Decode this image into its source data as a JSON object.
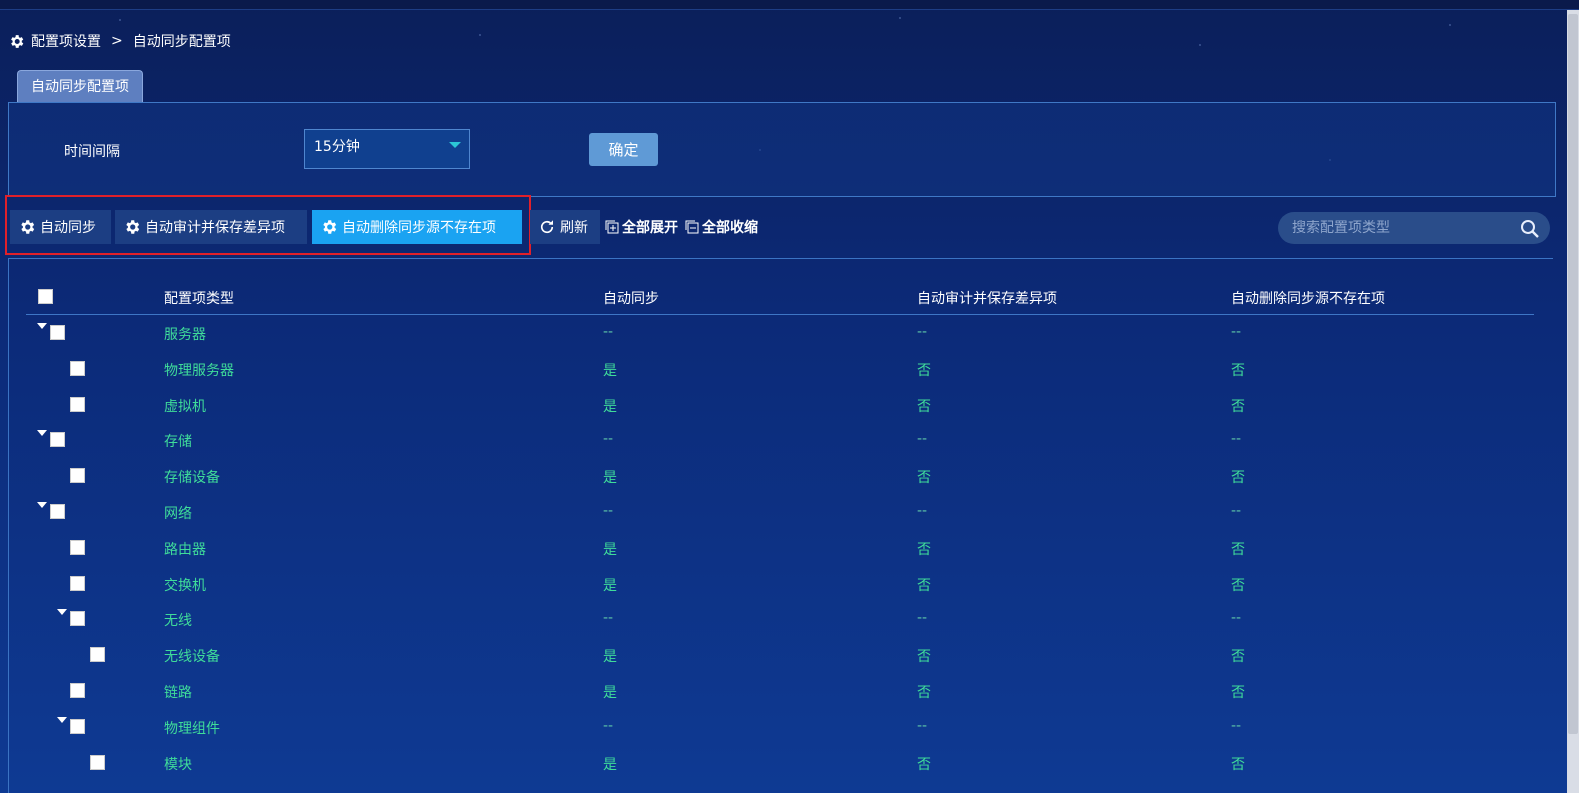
{
  "breadcrumb": {
    "parent": "配置项设置",
    "separator": ">",
    "current": "自动同步配置项"
  },
  "tab": {
    "label": "自动同步配置项"
  },
  "interval": {
    "label": "时间间隔",
    "value": "15分钟",
    "confirm": "确定"
  },
  "toolbar": {
    "auto_sync": "自动同步",
    "auto_audit": "自动审计并保存差异项",
    "auto_delete": "自动删除同步源不存在项",
    "refresh": "刷新",
    "expand_all": "全部展开",
    "collapse_all": "全部收缩"
  },
  "search": {
    "placeholder": "搜索配置项类型"
  },
  "columns": [
    "配置项类型",
    "自动同步",
    "自动审计并保存差异项",
    "自动删除同步源不存在项"
  ],
  "rows": [
    {
      "name": "服务器",
      "sync": "--",
      "audit": "--",
      "delete": "--",
      "level": 0,
      "group": true
    },
    {
      "name": "物理服务器",
      "sync": "是",
      "audit": "否",
      "delete": "否",
      "level": 1,
      "group": false
    },
    {
      "name": "虚拟机",
      "sync": "是",
      "audit": "否",
      "delete": "否",
      "level": 1,
      "group": false
    },
    {
      "name": "存储",
      "sync": "--",
      "audit": "--",
      "delete": "--",
      "level": 0,
      "group": true
    },
    {
      "name": "存储设备",
      "sync": "是",
      "audit": "否",
      "delete": "否",
      "level": 1,
      "group": false
    },
    {
      "name": "网络",
      "sync": "--",
      "audit": "--",
      "delete": "--",
      "level": 0,
      "group": true
    },
    {
      "name": "路由器",
      "sync": "是",
      "audit": "否",
      "delete": "否",
      "level": 1,
      "group": false
    },
    {
      "name": "交换机",
      "sync": "是",
      "audit": "否",
      "delete": "否",
      "level": 1,
      "group": false
    },
    {
      "name": "无线",
      "sync": "--",
      "audit": "--",
      "delete": "--",
      "level": 1,
      "group": true
    },
    {
      "name": "无线设备",
      "sync": "是",
      "audit": "否",
      "delete": "否",
      "level": 2,
      "group": false
    },
    {
      "name": "链路",
      "sync": "是",
      "audit": "否",
      "delete": "否",
      "level": 1,
      "group": false
    },
    {
      "name": "物理组件",
      "sync": "--",
      "audit": "--",
      "delete": "--",
      "level": 1,
      "group": true
    },
    {
      "name": "模块",
      "sync": "是",
      "audit": "否",
      "delete": "否",
      "level": 2,
      "group": false
    }
  ],
  "colors": {
    "accent": "#1aa3f2",
    "value_text": "#3fdc9a",
    "highlight": "#e0202a"
  }
}
